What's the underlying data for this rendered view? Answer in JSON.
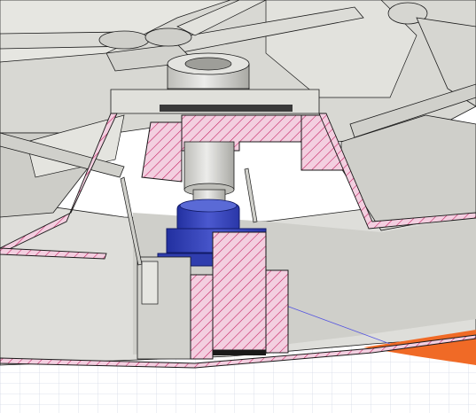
{
  "viewport": {
    "type": "cad-section-view",
    "background": "#ffffff"
  },
  "colors": {
    "body_gray": "#d6d6d1",
    "body_light": "#ebebe6",
    "body_shadow": "#b9b9b4",
    "section_pink": "#f3cfe0",
    "section_hatch": "#c2185b",
    "servo_blue": "#2d3ab0",
    "servo_blue_light": "#5a6ad6",
    "shaft_silver": "#dcdcd8",
    "grid_line": "#d5dae6",
    "accent_orange": "#f06a26",
    "axis_blue": "#5656e0",
    "edge": "#1a1a1a"
  },
  "icons": {
    "grid_plane": "ground-grid",
    "section_cut": "hatched-section"
  }
}
